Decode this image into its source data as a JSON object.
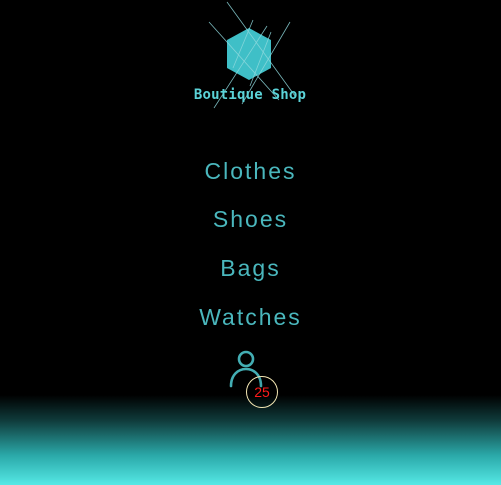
{
  "brand": {
    "name": "Boutique Shop",
    "logo_icon": "hexagon-logo-icon",
    "color": "#5bd3d8"
  },
  "nav": {
    "items": [
      {
        "label": "Clothes"
      },
      {
        "label": "Shoes"
      },
      {
        "label": "Bags"
      },
      {
        "label": "Watches"
      }
    ],
    "color": "#4ab7bd"
  },
  "account": {
    "icon": "user-icon",
    "badge_count": "25",
    "badge_color": "#ff1b1b"
  },
  "footer": {
    "gradient_color": "#55e9e6"
  }
}
